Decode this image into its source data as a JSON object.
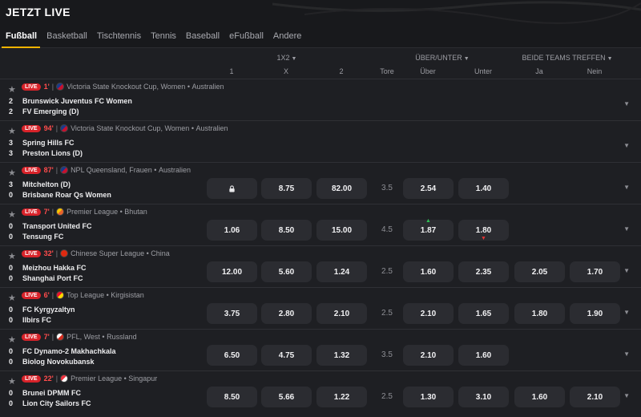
{
  "header": {
    "title": "JETZT LIVE"
  },
  "tabs": [
    {
      "label": "Fußball",
      "active": true
    },
    {
      "label": "Basketball"
    },
    {
      "label": "Tischtennis"
    },
    {
      "label": "Tennis"
    },
    {
      "label": "Baseball"
    },
    {
      "label": "eFußball"
    },
    {
      "label": "Andere"
    }
  ],
  "columns": {
    "groups": [
      "1X2",
      "ÜBER/UNTER",
      "BEIDE TEAMS TREFFEN"
    ],
    "labels": [
      "1",
      "X",
      "2",
      "Tore",
      "Über",
      "Unter",
      "Ja",
      "Nein"
    ]
  },
  "matches": [
    {
      "minute": "1'",
      "competition": "Victoria State Knockout Cup, Women",
      "country": "Australien",
      "flag_colors": [
        "#1b3a8a",
        "#c8102e"
      ],
      "home": "Brunswick Juventus FC Women",
      "away": "FV Emerging (D)",
      "score_home": "2",
      "score_away": "2",
      "odds": {}
    },
    {
      "minute": "94'",
      "competition": "Victoria State Knockout Cup, Women",
      "country": "Australien",
      "flag_colors": [
        "#1b3a8a",
        "#c8102e"
      ],
      "home": "Spring Hills FC",
      "away": "Preston Lions (D)",
      "score_home": "3",
      "score_away": "3",
      "odds": {}
    },
    {
      "minute": "87'",
      "competition": "NPL Queensland, Frauen",
      "country": "Australien",
      "flag_colors": [
        "#1b3a8a",
        "#c8102e"
      ],
      "home": "Mitchelton (D)",
      "away": "Brisbane Roar Qs Women",
      "score_home": "3",
      "score_away": "0",
      "odds": {
        "one": "lock",
        "x": "8.75",
        "two": "82.00",
        "tore": "3.5",
        "over": "2.54",
        "under": "1.40"
      }
    },
    {
      "minute": "7'",
      "competition": "Premier League",
      "country": "Bhutan",
      "flag_colors": [
        "#f6c500",
        "#e8632b"
      ],
      "home": "Transport United FC",
      "away": "Tensung FC",
      "score_home": "0",
      "score_away": "0",
      "odds": {
        "one": "1.06",
        "x": "8.50",
        "two": "15.00",
        "tore": "4.5",
        "over": "1.87",
        "under": "1.80"
      },
      "trend": {
        "over": "up",
        "under": "down"
      }
    },
    {
      "minute": "32'",
      "competition": "Chinese Super League",
      "country": "China",
      "flag_colors": [
        "#de2910",
        "#de2910"
      ],
      "home": "Meizhou Hakka FC",
      "away": "Shanghai Port FC",
      "score_home": "0",
      "score_away": "0",
      "odds": {
        "one": "12.00",
        "x": "5.60",
        "two": "1.24",
        "tore": "2.5",
        "over": "1.60",
        "under": "2.35",
        "ja": "2.05",
        "nein": "1.70"
      }
    },
    {
      "minute": "6'",
      "competition": "Top League",
      "country": "Kirgisistan",
      "flag_colors": [
        "#e8112d",
        "#ffd700"
      ],
      "home": "FC Kyrgyzaltyn",
      "away": "Ilbirs FC",
      "score_home": "0",
      "score_away": "0",
      "odds": {
        "one": "3.75",
        "x": "2.80",
        "two": "2.10",
        "tore": "2.5",
        "over": "2.10",
        "under": "1.65",
        "ja": "1.80",
        "nein": "1.90"
      }
    },
    {
      "minute": "7'",
      "competition": "PFL, West",
      "country": "Russland",
      "flag_colors": [
        "#ffffff",
        "#d52b1e"
      ],
      "home": "FC Dynamo-2 Makhachkala",
      "away": "Biolog Novokubansk",
      "score_home": "0",
      "score_away": "0",
      "odds": {
        "one": "6.50",
        "x": "4.75",
        "two": "1.32",
        "tore": "3.5",
        "over": "2.10",
        "under": "1.60"
      }
    },
    {
      "minute": "22'",
      "competition": "Premier League",
      "country": "Singapur",
      "flag_colors": [
        "#ef3340",
        "#ffffff"
      ],
      "home": "Brunei DPMM FC",
      "away": "Lion City Sailors FC",
      "score_home": "0",
      "score_away": "0",
      "odds": {
        "one": "8.50",
        "x": "5.66",
        "two": "1.22",
        "tore": "2.5",
        "over": "1.30",
        "under": "3.10",
        "ja": "1.60",
        "nein": "2.10"
      }
    }
  ],
  "colors": {
    "accent": "#f5b400",
    "live": "#d8232a",
    "minute": "#ff4d4d",
    "cell": "#2b2c31",
    "background": "#1e1f23"
  }
}
